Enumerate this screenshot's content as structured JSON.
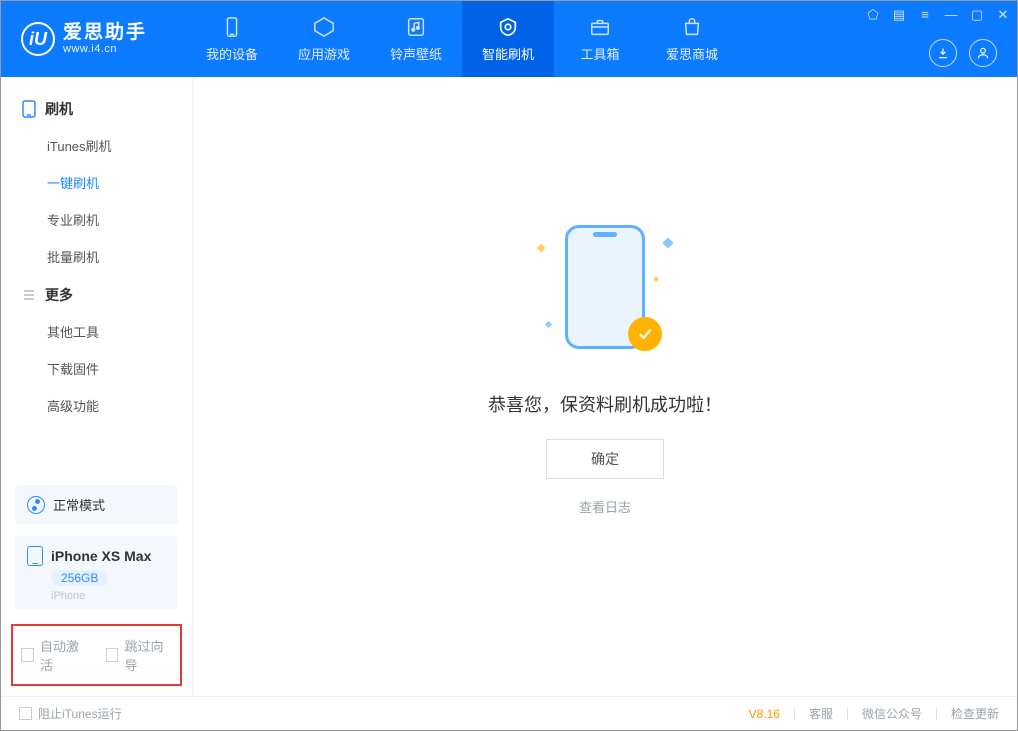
{
  "brand": {
    "title": "爱思助手",
    "subtitle": "www.i4.cn",
    "logo_letter": "iU"
  },
  "nav": {
    "items": [
      {
        "label": "我的设备",
        "icon": "device-icon"
      },
      {
        "label": "应用游戏",
        "icon": "apps-icon"
      },
      {
        "label": "铃声壁纸",
        "icon": "ringtone-icon"
      },
      {
        "label": "智能刷机",
        "icon": "flash-icon"
      },
      {
        "label": "工具箱",
        "icon": "toolbox-icon"
      },
      {
        "label": "爱思商城",
        "icon": "store-icon"
      }
    ],
    "active_index": 3
  },
  "titlebar": {
    "t1": "tshirt-icon",
    "t2": "list-icon",
    "t3": "menu-icon",
    "min": "minimize-icon",
    "max": "maximize-icon",
    "close": "close-icon"
  },
  "header_buttons": {
    "download": "download-icon",
    "user": "user-icon"
  },
  "sidebar": {
    "group1": {
      "title": "刷机",
      "items": [
        "iTunes刷机",
        "一键刷机",
        "专业刷机",
        "批量刷机"
      ],
      "active_index": 1
    },
    "group2": {
      "title": "更多",
      "items": [
        "其他工具",
        "下载固件",
        "高级功能"
      ]
    },
    "mode": {
      "label": "正常模式"
    },
    "device": {
      "name": "iPhone XS Max",
      "capacity": "256GB",
      "type": "iPhone"
    },
    "bottom_checks": {
      "c1": "自动激活",
      "c2": "跳过向导"
    }
  },
  "main": {
    "success_message": "恭喜您，保资料刷机成功啦！",
    "ok_button": "确定",
    "view_log": "查看日志"
  },
  "status": {
    "block_itunes": "阻止iTunes运行",
    "version": "V8.16",
    "links": [
      "客服",
      "微信公众号",
      "检查更新"
    ]
  }
}
